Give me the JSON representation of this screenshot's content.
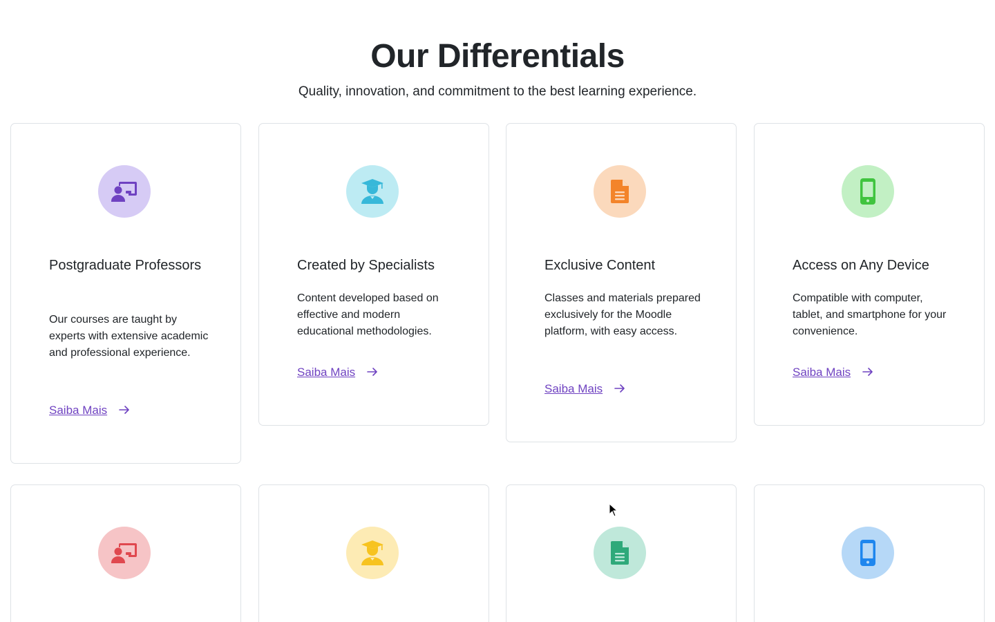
{
  "section": {
    "title": "Our Differentials",
    "subtitle": "Quality, innovation, and commitment to the best learning experience."
  },
  "cards_row1": [
    {
      "title": "Postgraduate Professors",
      "text": "Our courses are taught by experts with extensive academic and professional experience.",
      "link": "Saiba Mais",
      "icon": "teacher-board-icon",
      "icon_color": "#6f42c1",
      "bg_color": "#d6cbf5"
    },
    {
      "title": "Created by Specialists",
      "text": "Content developed based on effective and modern educational methodologies.",
      "link": "Saiba Mais",
      "icon": "graduate-icon",
      "icon_color": "#37b8d9",
      "bg_color": "#bdebf3"
    },
    {
      "title": "Exclusive Content",
      "text": "Classes and materials prepared exclusively for the Moodle platform, with easy access.",
      "link": "Saiba Mais",
      "icon": "document-icon",
      "icon_color": "#f3842a",
      "bg_color": "#fbd9bc"
    },
    {
      "title": "Access on Any Device",
      "text": "Compatible with computer, tablet, and smartphone for your convenience.",
      "link": "Saiba Mais",
      "icon": "smartphone-icon",
      "icon_color": "#40c43f",
      "bg_color": "#c2f0c4"
    }
  ],
  "cards_row2": [
    {
      "icon": "teacher-board-icon",
      "icon_color": "#e0484f",
      "bg_color": "#f6c4c6"
    },
    {
      "icon": "graduate-icon",
      "icon_color": "#f7c31f",
      "bg_color": "#fdebb4"
    },
    {
      "icon": "document-icon",
      "icon_color": "#2fa97a",
      "bg_color": "#bfe8da"
    },
    {
      "icon": "smartphone-icon",
      "icon_color": "#1e86ee",
      "bg_color": "#b6d8f7"
    }
  ]
}
